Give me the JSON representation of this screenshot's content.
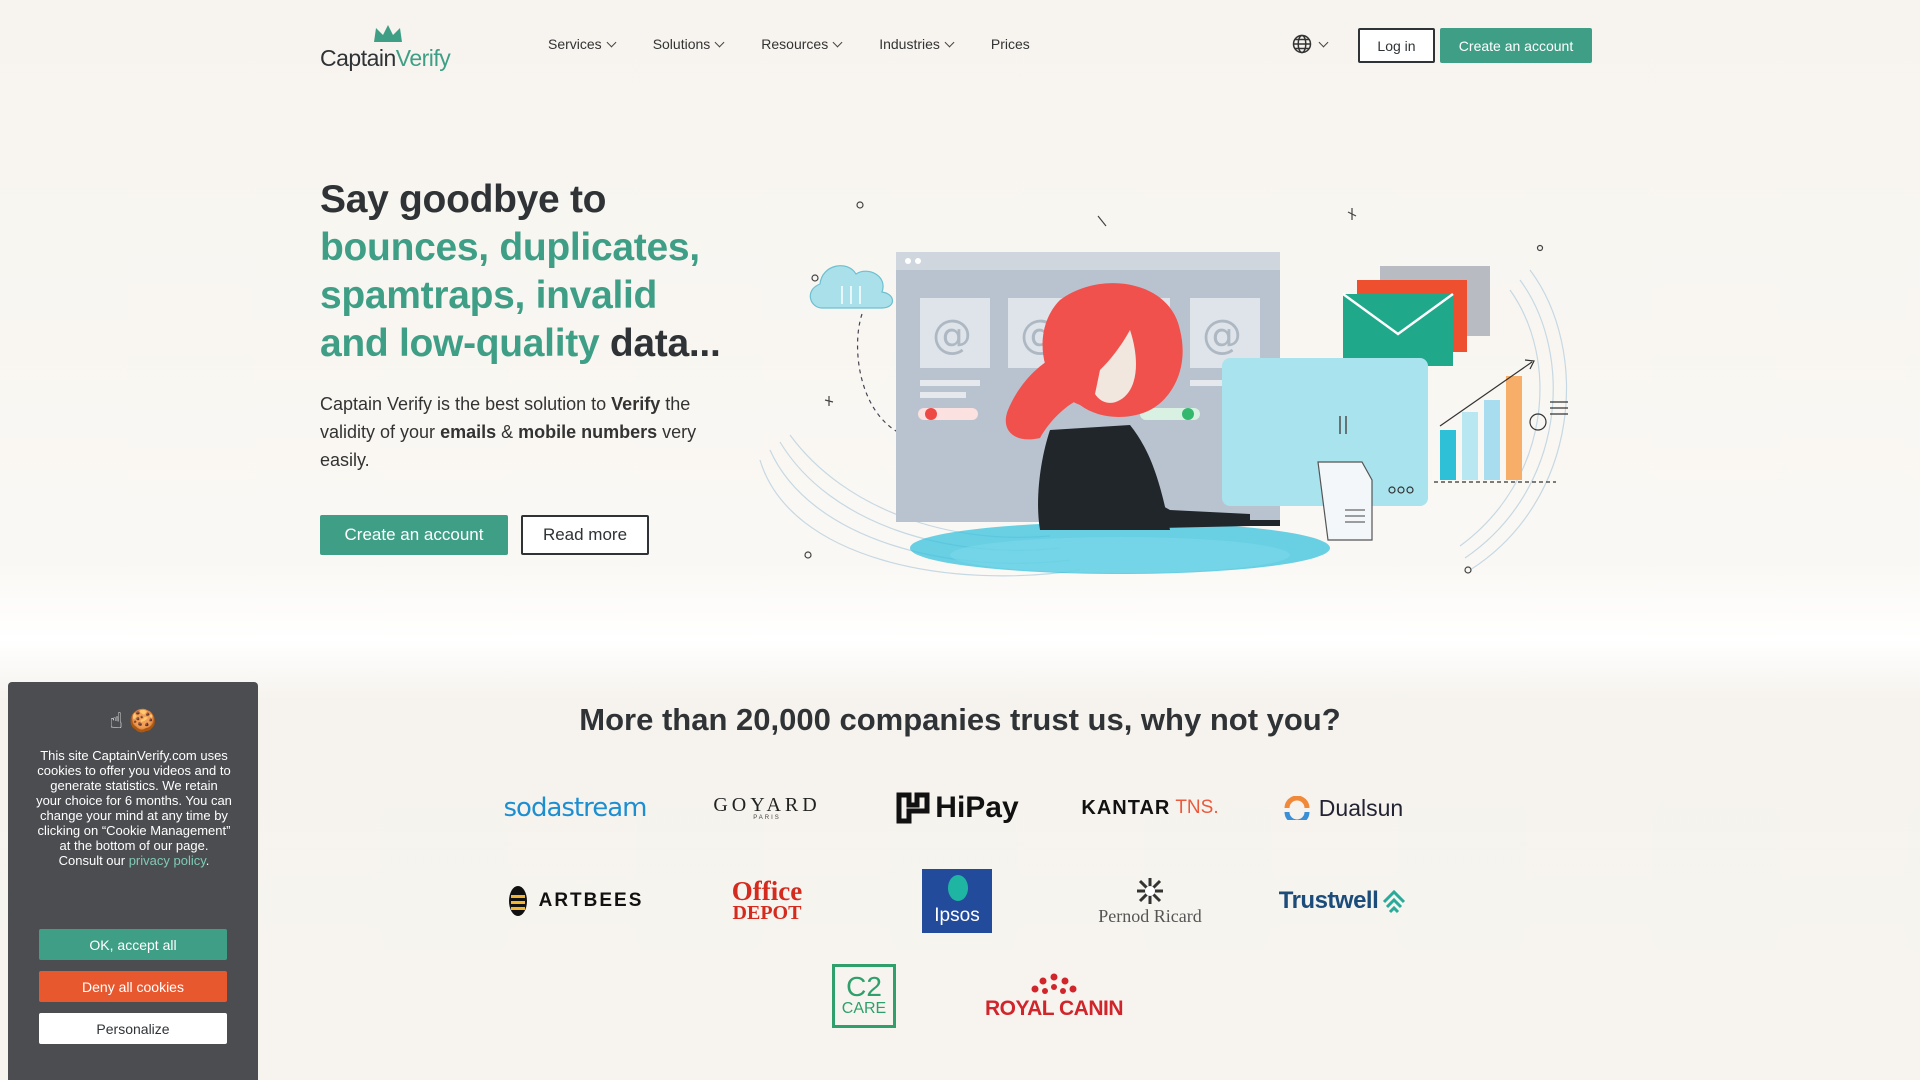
{
  "brand": {
    "name_part1": "Captain",
    "name_part2": "Verify",
    "accent": "#3f9f86"
  },
  "nav": {
    "items": [
      {
        "label": "Services",
        "has_dropdown": true
      },
      {
        "label": "Solutions",
        "has_dropdown": true
      },
      {
        "label": "Resources",
        "has_dropdown": true
      },
      {
        "label": "Industries",
        "has_dropdown": true
      },
      {
        "label": "Prices",
        "has_dropdown": false
      }
    ],
    "language_icon": "globe-icon",
    "login_label": "Log in",
    "create_label": "Create an account"
  },
  "hero": {
    "title_lead": "Say goodbye to",
    "title_line2": "bounces, duplicates,",
    "title_line3": "spamtraps, invalid",
    "title_line4_green": "and low-quality",
    "title_line4_tail": " data...",
    "text_1": "Captain Verify is the best solution to ",
    "text_verify": "Verify",
    "text_2": " the validity of your ",
    "text_emails": "emails",
    "text_3": " & ",
    "text_mobile": "mobile numbers",
    "text_4": " very easily.",
    "create_label": "Create an account",
    "readmore_label": "Read more"
  },
  "trust": {
    "title": "More than 20,000 companies trust us, why not you?",
    "logos": [
      {
        "text": "sodastream"
      },
      {
        "text": "GOYARD",
        "sub": "PARIS"
      },
      {
        "text": "HiPay"
      },
      {
        "text": "KANTAR",
        "suffix": "TNS."
      },
      {
        "text": "Dualsun"
      },
      {
        "text": "ARTBEES"
      },
      {
        "text": "Office",
        "line2": "DEPOT"
      },
      {
        "text": "Ipsos"
      },
      {
        "text": "Pernod Ricard"
      },
      {
        "text": "Trustwell"
      },
      {
        "text": "C2",
        "line2": "CARE"
      },
      {
        "text": "ROYAL CANIN"
      }
    ]
  },
  "cookie": {
    "emoji": "☝ 🍪",
    "text": "This site CaptainVerify.com uses cookies to offer you videos and to generate statistics. We retain your choice for 6 months. You can change your mind at any time by clicking on “Cookie Management” at the bottom of our page. Consult our ",
    "link": "privacy policy",
    "link_tail": ".",
    "accept_label": "OK, accept all",
    "deny_label": "Deny all cookies",
    "personalize_label": "Personalize"
  },
  "colors": {
    "green": "#3f9f86",
    "deny": "#e8582f",
    "dark": "#2f3336",
    "cookie_bg": "#4b4d50"
  }
}
